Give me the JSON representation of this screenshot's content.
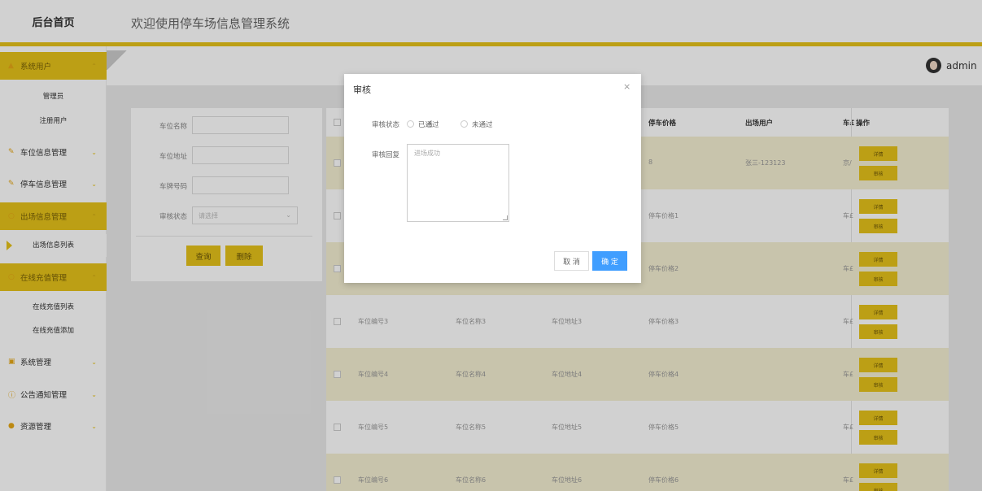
{
  "header": {
    "brand": "后台首页",
    "title": "欢迎使用停车场信息管理系统"
  },
  "user": {
    "name": "admin"
  },
  "sidebar": {
    "menus": [
      {
        "label": "系统用户",
        "icon": "user-icon"
      },
      {
        "label": "车位信息管理",
        "icon": "edit-icon"
      },
      {
        "label": "停车信息管理",
        "icon": "edit-icon"
      },
      {
        "label": "出场信息管理",
        "icon": "circle-icon"
      },
      {
        "label": "在线充值管理",
        "icon": "circle-icon"
      },
      {
        "label": "系统管理",
        "icon": "image-icon"
      },
      {
        "label": "公告通知管理",
        "icon": "info-icon"
      },
      {
        "label": "资源管理",
        "icon": "pin-icon"
      }
    ],
    "sub_users": [
      "管理员",
      "注册用户"
    ],
    "sub_exit": [
      "出场信息列表"
    ],
    "sub_recharge": [
      "在线充值列表",
      "在线充值添加"
    ]
  },
  "search": {
    "labels": [
      "车位名称",
      "车位地址",
      "车牌号码",
      "审核状态"
    ],
    "select_placeholder": "请选择",
    "query_label": "查询",
    "delete_label": "删除"
  },
  "table": {
    "headers": {
      "price": "停车价格",
      "user": "出场用户",
      "plate": "车£",
      "ops": "操作"
    },
    "rows": [
      {
        "code": "",
        "name": "",
        "addr": "",
        "price": "8",
        "user": "张三-123123",
        "plate": "京/"
      },
      {
        "code": "",
        "name": "",
        "addr": "",
        "price": "停车价格1",
        "user": "",
        "plate": "车£"
      },
      {
        "code": "",
        "name": "",
        "addr": "",
        "price": "停车价格2",
        "user": "",
        "plate": "车£"
      },
      {
        "code": "车位编号3",
        "name": "车位名称3",
        "addr": "车位地址3",
        "price": "停车价格3",
        "user": "",
        "plate": "车£"
      },
      {
        "code": "车位编号4",
        "name": "车位名称4",
        "addr": "车位地址4",
        "price": "停车价格4",
        "user": "",
        "plate": "车£"
      },
      {
        "code": "车位编号5",
        "name": "车位名称5",
        "addr": "车位地址5",
        "price": "停车价格5",
        "user": "",
        "plate": "车£"
      },
      {
        "code": "车位编号6",
        "name": "车位名称6",
        "addr": "车位地址6",
        "price": "停车价格6",
        "user": "",
        "plate": "车£"
      }
    ],
    "op_detail": "详情",
    "op_audit": "审核"
  },
  "modal": {
    "title": "审核",
    "close": "×",
    "status_label": "审核状态",
    "option_pass": "已通过",
    "option_fail": "未通过",
    "reply_label": "审核回复",
    "reply_value": "进场成功",
    "cancel_label": "取 消",
    "ok_label": "确 定"
  },
  "colors": {
    "accent": "#e6c21a",
    "primary": "#409eff"
  }
}
